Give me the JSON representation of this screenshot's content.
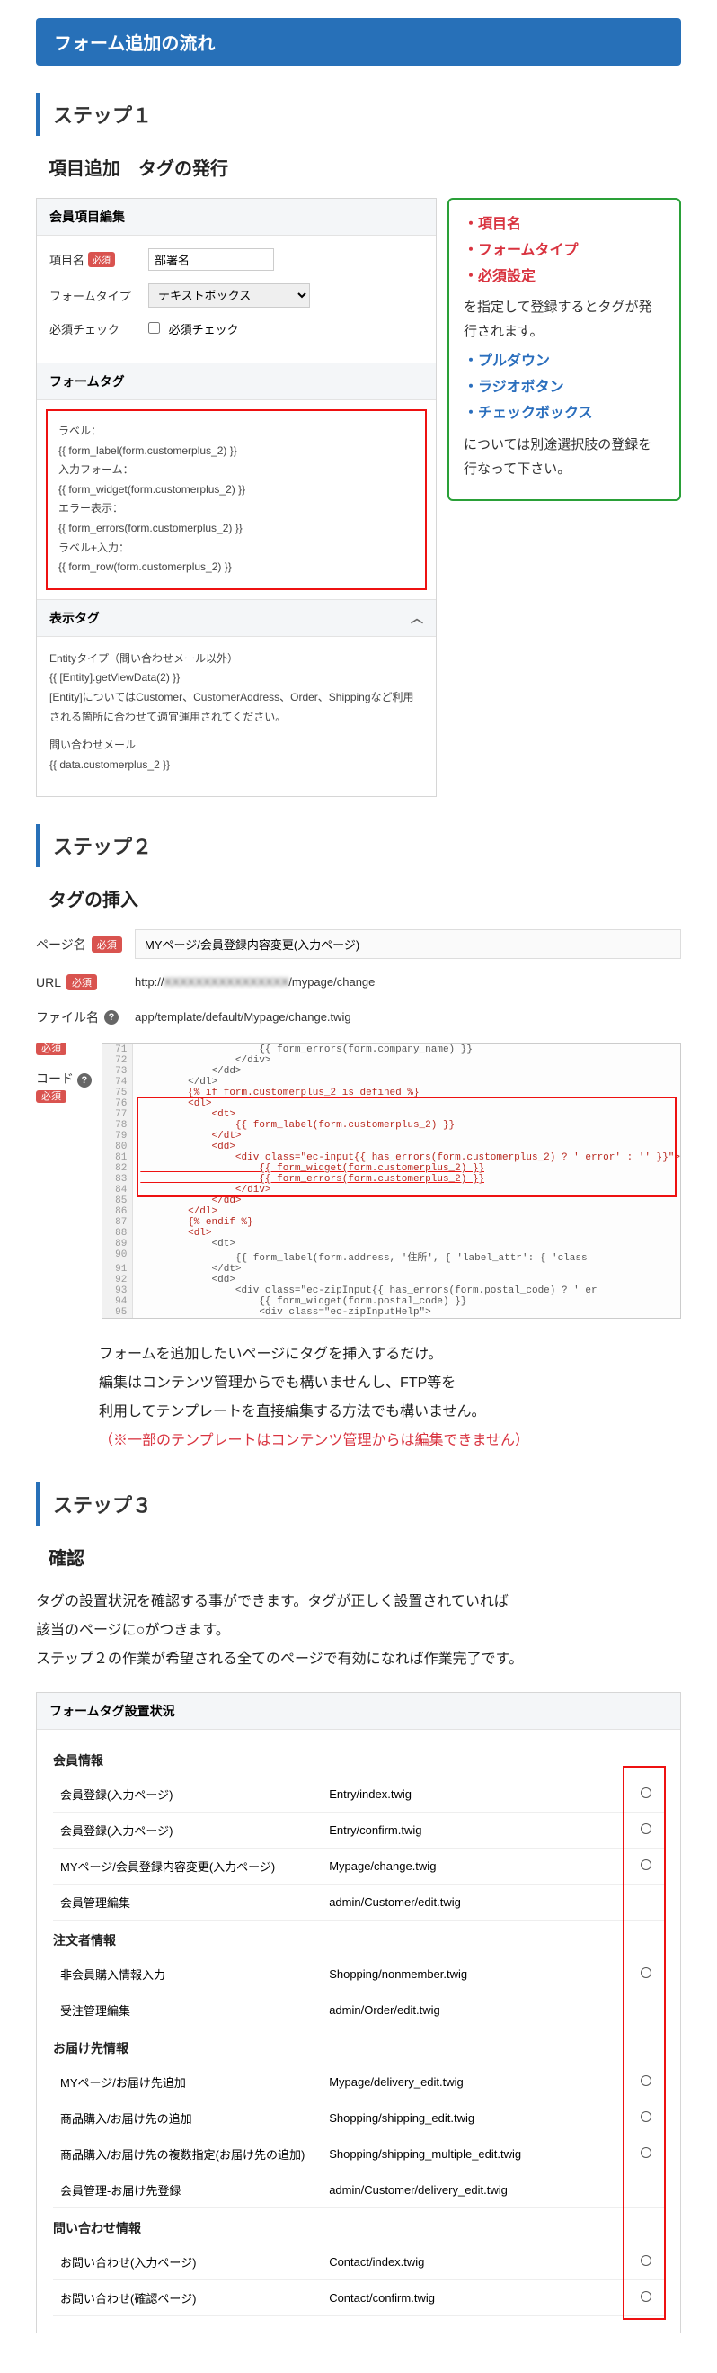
{
  "title": "フォーム追加の流れ",
  "step1": {
    "header": "ステップ１",
    "sub": "項目追加　タグの発行",
    "editPanel": "会員項目編集",
    "labels": {
      "itemName": "項目名",
      "formType": "フォームタイプ",
      "required": "必須チェック"
    },
    "values": {
      "itemName": "部署名",
      "formType": "テキストボックス",
      "requiredCheckbox": "必須チェック"
    },
    "formTagSection": "フォームタグ",
    "formTagLines": [
      "ラベル：",
      "{{ form_label(form.customerplus_2) }}",
      "入力フォーム：",
      "{{ form_widget(form.customerplus_2) }}",
      "エラー表示：",
      "{{ form_errors(form.customerplus_2) }}",
      "ラベル+入力：",
      "{{ form_row(form.customerplus_2) }}"
    ],
    "displayTagSection": "表示タグ",
    "entityLine1": "Entityタイプ（問い合わせメール以外）",
    "entityLine2": "{{ [Entity].getViewData(2) }}",
    "entityLine3": "[Entity]についてはCustomer、CustomerAddress、Order、Shippingなど利用される箇所に合わせて適宜運用されてください。",
    "contactLine1": "問い合わせメール",
    "contactLine2": "{{ data.customerplus_2 }}",
    "green": {
      "items1": [
        "・項目名",
        "・フォームタイプ",
        "・必須設定"
      ],
      "note1": "を指定して登録するとタグが発行されます。",
      "items2": [
        "・プルダウン",
        "・ラジオボタン",
        "・チェックボックス"
      ],
      "note2": "については別途選択肢の登録を行なって下さい。"
    }
  },
  "step2": {
    "header": "ステップ２",
    "sub": "タグの挿入",
    "labels": {
      "pageName": "ページ名",
      "url": "URL",
      "fileName": "ファイル名",
      "code": "コード"
    },
    "values": {
      "pageName": "MYページ/会員登録内容変更(入力ページ)",
      "url_pre": "http://",
      "url_mid": "XXXXXXXXXXXXXXXX",
      "url_post": "/mypage/change",
      "fileName": "app/template/default/Mypage/change.twig"
    },
    "code": [
      {
        "n": 71,
        "t": "                    {{ form_errors(form.company_name) }}"
      },
      {
        "n": 72,
        "t": "                </div>"
      },
      {
        "n": 73,
        "t": "            </dd>"
      },
      {
        "n": 74,
        "t": "        </dl>"
      },
      {
        "n": 75,
        "t": "        {% if form.customerplus_2 is defined %}"
      },
      {
        "n": 76,
        "t": "        <dl>"
      },
      {
        "n": 77,
        "t": "            <dt>"
      },
      {
        "n": 78,
        "t": "                {{ form_label(form.customerplus_2) }}"
      },
      {
        "n": 79,
        "t": "            </dt>"
      },
      {
        "n": 80,
        "t": "            <dd>"
      },
      {
        "n": 81,
        "t": "                <div class=\"ec-input{{ has_errors(form.customerplus_2) ? ' error' : '' }}\">"
      },
      {
        "n": 82,
        "t": "                    {{ form_widget(form.customerplus_2) }}"
      },
      {
        "n": 83,
        "t": "                    {{ form_errors(form.customerplus_2) }}"
      },
      {
        "n": 84,
        "t": "                </div>"
      },
      {
        "n": 85,
        "t": "            </dd>"
      },
      {
        "n": 86,
        "t": "        </dl>"
      },
      {
        "n": 87,
        "t": "        {% endif %}"
      },
      {
        "n": 88,
        "t": "        <dl>"
      },
      {
        "n": 89,
        "t": "            <dt>"
      },
      {
        "n": 90,
        "t": "                {{ form_label(form.address, '住所', { 'label_attr': { 'class"
      },
      {
        "n": 91,
        "t": "            </dt>"
      },
      {
        "n": 92,
        "t": "            <dd>"
      },
      {
        "n": 93,
        "t": "                <div class=\"ec-zipInput{{ has_errors(form.postal_code) ? ' er"
      },
      {
        "n": 94,
        "t": "                    {{ form_widget(form.postal_code) }}"
      },
      {
        "n": 95,
        "t": "                    <div class=\"ec-zipInputHelp\">"
      }
    ],
    "notes": [
      "フォームを追加したいページにタグを挿入するだけ。",
      "編集はコンテンツ管理からでも構いませんし、FTP等を",
      "利用してテンプレートを直接編集する方法でも構いません。",
      "（※一部のテンプレートはコンテンツ管理からは編集できません）"
    ]
  },
  "step3": {
    "header": "ステップ３",
    "sub": "確認",
    "desc": [
      "タグの設置状況を確認する事ができます。タグが正しく設置されていれば",
      "該当のページに○がつきます。",
      "ステップ２の作業が希望される全てのページで有効になれば作業完了です。"
    ],
    "panelTitle": "フォームタグ設置状況",
    "groups": [
      {
        "title": "会員情報",
        "rows": [
          {
            "name": "会員登録(入力ページ)",
            "path": "Entry/index.twig",
            "ok": true
          },
          {
            "name": "会員登録(入力ページ)",
            "path": "Entry/confirm.twig",
            "ok": true
          },
          {
            "name": "MYページ/会員登録内容変更(入力ページ)",
            "path": "Mypage/change.twig",
            "ok": true
          },
          {
            "name": "会員管理編集",
            "path": "admin/Customer/edit.twig",
            "ok": false
          }
        ]
      },
      {
        "title": "注文者情報",
        "rows": [
          {
            "name": "非会員購入情報入力",
            "path": "Shopping/nonmember.twig",
            "ok": true
          },
          {
            "name": "受注管理編集",
            "path": "admin/Order/edit.twig",
            "ok": false
          }
        ]
      },
      {
        "title": "お届け先情報",
        "rows": [
          {
            "name": "MYページ/お届け先追加",
            "path": "Mypage/delivery_edit.twig",
            "ok": true
          },
          {
            "name": "商品購入/お届け先の追加",
            "path": "Shopping/shipping_edit.twig",
            "ok": true
          },
          {
            "name": "商品購入/お届け先の複数指定(お届け先の追加)",
            "path": "Shopping/shipping_multiple_edit.twig",
            "ok": true
          },
          {
            "name": "会員管理-お届け先登録",
            "path": "admin/Customer/delivery_edit.twig",
            "ok": false
          }
        ]
      },
      {
        "title": "問い合わせ情報",
        "rows": [
          {
            "name": "お問い合わせ(入力ページ)",
            "path": "Contact/index.twig",
            "ok": true
          },
          {
            "name": "お問い合わせ(確認ページ)",
            "path": "Contact/confirm.twig",
            "ok": true
          }
        ]
      }
    ]
  },
  "badge": "必須"
}
